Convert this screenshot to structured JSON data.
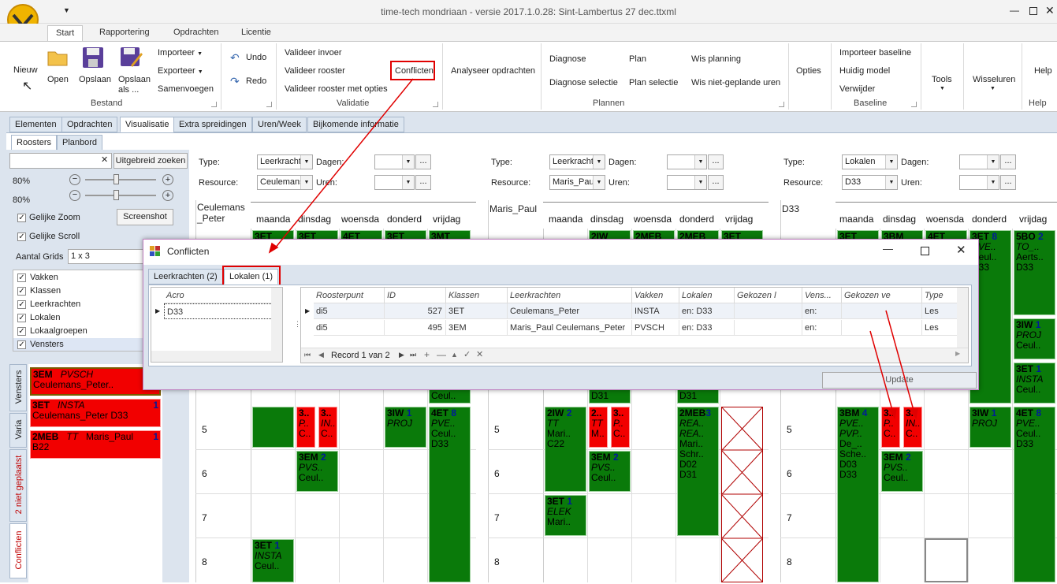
{
  "window": {
    "title": "time-tech mondriaan - versie 2017.1.0.28: Sint-Lambertus 27 dec.ttxml"
  },
  "ribbon_tabs": [
    "Start",
    "Rapportering",
    "Opdrachten",
    "Licentie"
  ],
  "ribbon": {
    "bestand": {
      "label": "Bestand",
      "nieuw": "Nieuw",
      "open": "Open",
      "opslaan": "Opslaan",
      "opslaan_als": "Opslaan als ...",
      "importeer": "Importeer",
      "exporteer": "Exporteer",
      "samenvoegen": "Samenvoegen"
    },
    "undo": "Undo",
    "redo": "Redo",
    "validatie": {
      "label": "Validatie",
      "invoer": "Valideer invoer",
      "rooster": "Valideer rooster",
      "opties": "Valideer rooster met opties",
      "conflicten": "Conflicten"
    },
    "analyseer": "Analyseer opdrachten",
    "plannen": {
      "label": "Plannen",
      "diagnose": "Diagnose",
      "diagnose_selectie": "Diagnose selectie",
      "plan": "Plan",
      "plan_selectie": "Plan selectie",
      "wis_planning": "Wis planning",
      "wis_niet": "Wis niet-geplande uren"
    },
    "opties": "Opties",
    "baseline": {
      "label": "Baseline",
      "importeer": "Importeer baseline",
      "huidig": "Huidig model",
      "verwijder": "Verwijder"
    },
    "tools": "Tools",
    "wisseluren": "Wisseluren",
    "help": "Help",
    "help_group": "Help"
  },
  "main_tabs": [
    "Elementen",
    "Opdrachten",
    "Visualisatie",
    "Extra spreidingen",
    "Uren/Week",
    "Bijkomende informatie"
  ],
  "sub_tabs": [
    "Roosters",
    "Planbord"
  ],
  "left": {
    "search_value": "",
    "search_button": "Uitgebreid zoeken",
    "zoom1": "80%",
    "zoom2": "80%",
    "gelijke_zoom": "Gelijke Zoom",
    "gelijke_scroll": "Gelijke Scroll",
    "screenshot": "Screenshot",
    "aantal_grids_label": "Aantal Grids",
    "aantal_grids_value": "1 x 3",
    "checks": [
      "Vakken",
      "Klassen",
      "Leerkrachten",
      "Lokalen",
      "Lokaalgroepen",
      "Vensters"
    ],
    "side_tabs": [
      "Vensters",
      "Varia",
      "2 niet geplaatst",
      "Conflicten"
    ],
    "conflict_items": [
      {
        "a": "3EM",
        "b": "PVSCH",
        "c": "Ceulemans_Peter..",
        "n": ""
      },
      {
        "a": "3ET",
        "b": "INSTA",
        "c": "Ceulemans_Peter   D33",
        "n": "1"
      },
      {
        "a": "2MEB",
        "b": "TT",
        "c": "Maris_Paul",
        "d": "B22",
        "n": "1"
      }
    ]
  },
  "filter_labels": {
    "type": "Type:",
    "dagen": "Dagen:",
    "resource": "Resource:",
    "uren": "Uren:"
  },
  "grids": [
    {
      "type": "Leerkracht",
      "resource": "Ceulemans",
      "title": "Ceulemans _Peter"
    },
    {
      "type": "Leerkracht",
      "resource": "Maris_Paul",
      "title": "Maris_Paul"
    },
    {
      "type": "Lokalen",
      "resource": "D33",
      "title": "D33"
    }
  ],
  "days": [
    "maanda",
    "dinsdag",
    "woensda",
    "donderd",
    "vrijdag"
  ],
  "hours": [
    "5",
    "6",
    "7",
    "8"
  ],
  "dialog": {
    "title": "Conflicten",
    "tabs": [
      "Leerkrachten (2)",
      "Lokalen (1)"
    ],
    "left_header": "Acro",
    "left_rows": [
      "D33"
    ],
    "columns": [
      "Roosterpunt",
      "ID",
      "Klassen",
      "Leerkrachten",
      "Vakken",
      "Lokalen",
      "Gekozen l",
      "Vens...",
      "Gekozen ve",
      "Type"
    ],
    "rows": [
      [
        "di5",
        "527",
        "3ET",
        "Ceulemans_Peter",
        "INSTA",
        "en: D33",
        "",
        "en:",
        "",
        "Les"
      ],
      [
        "di5",
        "495",
        "3EM",
        "Maris_Paul Ceulemans_Peter",
        "PVSCH",
        "en: D33",
        "",
        "en:",
        "",
        "Les"
      ]
    ],
    "record": "Record 1 van 2",
    "update": "Update"
  },
  "colors": {
    "green": "#0a7a0a",
    "red": "#f20000",
    "accent": "#e00000"
  }
}
